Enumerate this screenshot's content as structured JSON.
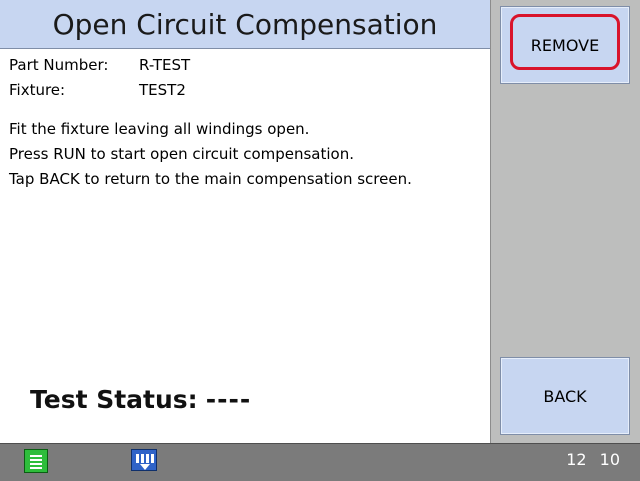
{
  "title": "Open Circuit Compensation",
  "part_number": {
    "label": "Part Number:",
    "value": "R-TEST"
  },
  "fixture": {
    "label": "Fixture:",
    "value": "TEST2"
  },
  "instructions": [
    "Fit the fixture leaving all windings open.",
    "Press RUN to start open circuit compensation.",
    "Tap BACK to return to the main compensation screen."
  ],
  "status": {
    "label": "Test Status:",
    "value": "----"
  },
  "buttons": {
    "remove": "REMOVE",
    "back": "BACK"
  },
  "footer": {
    "time": "12 10",
    "icons": [
      "list-icon",
      "network-download-icon"
    ]
  },
  "colors": {
    "title_bar": "#c7d6f1",
    "button": "#c7d6f1",
    "highlight": "#d9142b",
    "footer": "#7b7b7b"
  }
}
